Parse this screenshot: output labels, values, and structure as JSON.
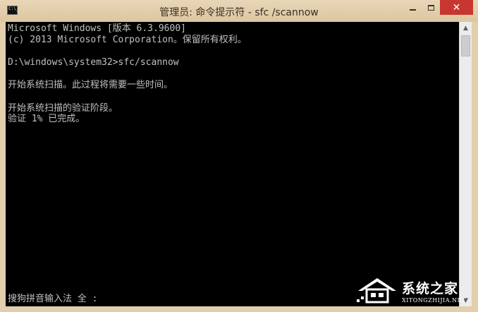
{
  "window": {
    "title": "管理员: 命令提示符 - sfc  /scannow",
    "icon_label": "C:\\_",
    "buttons": {
      "minimize_icon": "minimize-icon",
      "maximize_icon": "maximize-icon",
      "close_icon": "close-icon",
      "close_glyph": "✕"
    }
  },
  "console": {
    "lines": [
      "Microsoft Windows [版本 6.3.9600]",
      "(c) 2013 Microsoft Corporation。保留所有权利。",
      "",
      "D:\\windows\\system32>sfc/scannow",
      "",
      "开始系统扫描。此过程将需要一些时间。",
      "",
      "开始系统扫描的验证阶段。",
      "验证 1% 已完成。"
    ],
    "ime_status": "搜狗拼音输入法 全 :"
  },
  "scrollbar": {
    "up_glyph": "▲",
    "down_glyph": "▼"
  },
  "watermark": {
    "title": "系统之家",
    "subtitle": "XITONGZHIJIA.NET"
  },
  "colors": {
    "console_bg": "#000000",
    "console_text": "#c0c0c0",
    "titlebar": "#e3cfad",
    "close_button": "#c7372f"
  }
}
